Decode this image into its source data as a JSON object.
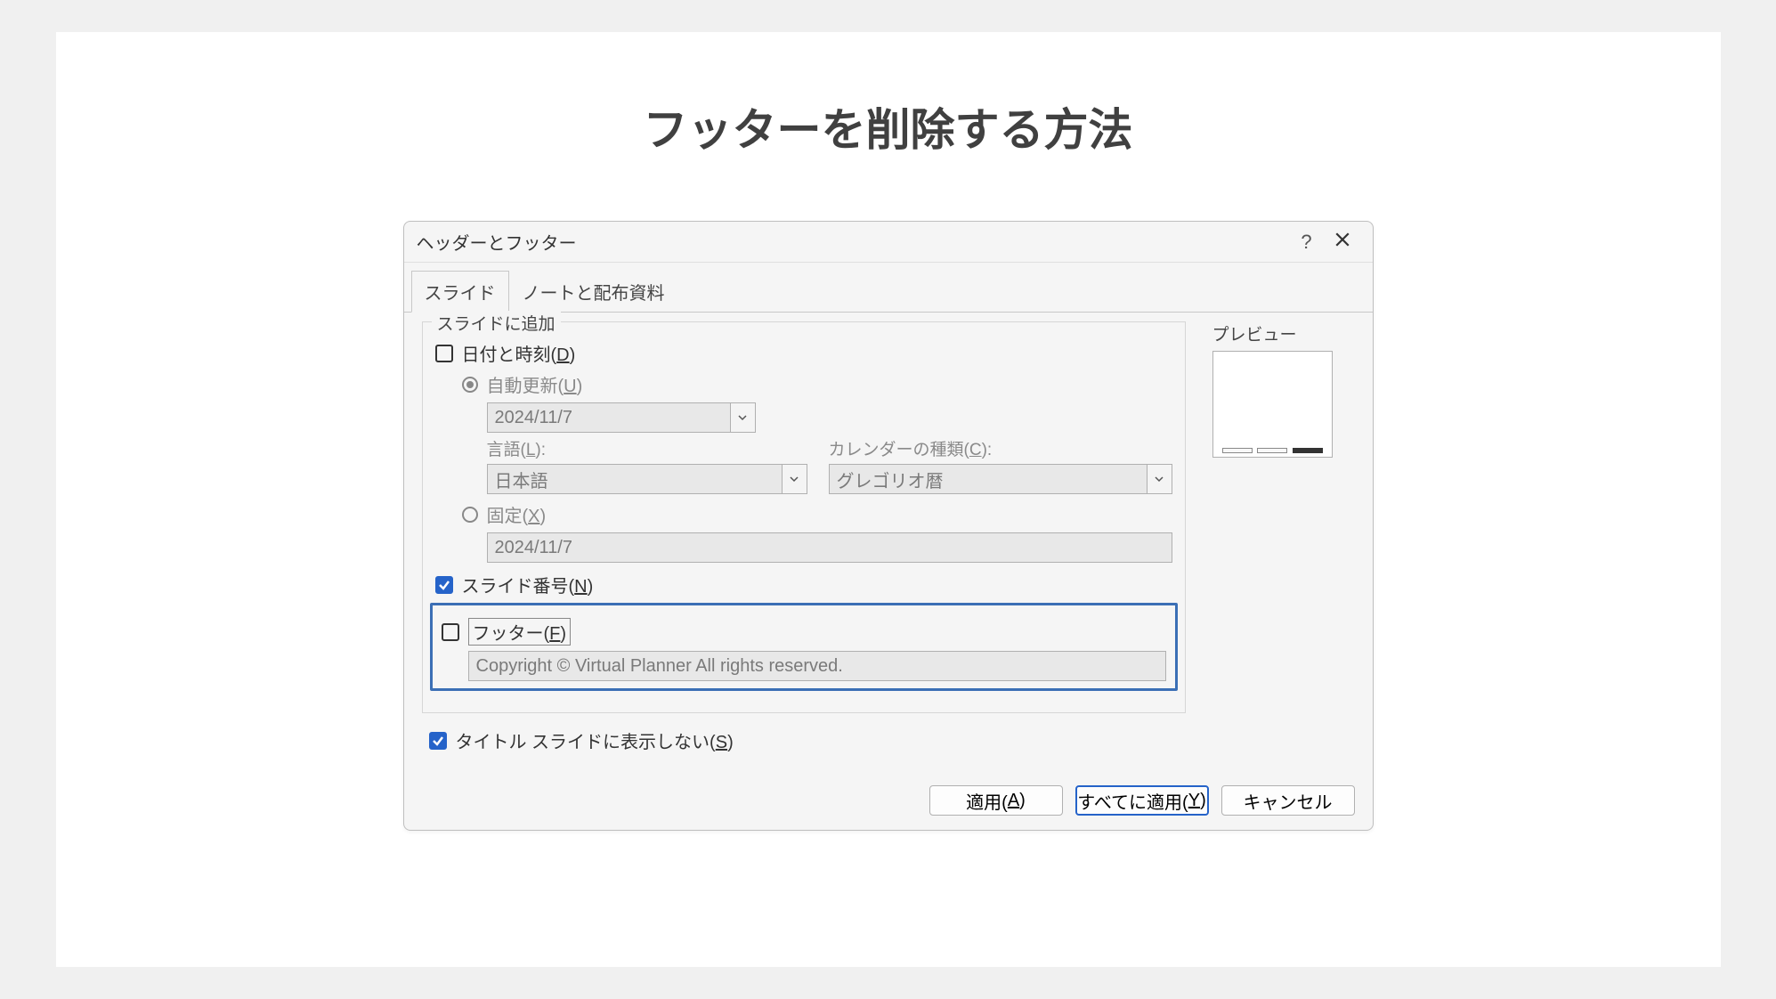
{
  "slide": {
    "title": "フッターを削除する方法"
  },
  "dialog": {
    "title": "ヘッダーとフッター",
    "help": "?",
    "tabs": {
      "slide": "スライド",
      "notes": "ノートと配布資料"
    },
    "group_legend": "スライドに追加",
    "datetime": {
      "label_pre": "日付と時刻(",
      "label_u": "D",
      "label_post": ")",
      "auto_pre": "自動更新(",
      "auto_u": "U",
      "auto_post": ")",
      "auto_value": "2024/11/7",
      "lang_label_pre": "言語(",
      "lang_label_u": "L",
      "lang_label_post": "):",
      "lang_value": "日本語",
      "cal_label_pre": "カレンダーの種類(",
      "cal_label_u": "C",
      "cal_label_post": "):",
      "cal_value": "グレゴリオ暦",
      "fixed_pre": "固定(",
      "fixed_u": "X",
      "fixed_post": ")",
      "fixed_value": "2024/11/7"
    },
    "slidenum": {
      "pre": "スライド番号(",
      "u": "N",
      "post": ")"
    },
    "footer": {
      "pre": "フッター(",
      "u": "F",
      "post": ")",
      "value": "Copyright © Virtual Planner All rights reserved."
    },
    "hide_title": {
      "pre": "タイトル スライドに表示しない(",
      "u": "S",
      "post": ")"
    },
    "preview_legend": "プレビュー",
    "buttons": {
      "apply_pre": "適用(",
      "apply_u": "A",
      "apply_post": ")",
      "apply_all_pre": "すべてに適用(",
      "apply_all_u": "Y",
      "apply_all_post": ")",
      "cancel": "キャンセル"
    }
  }
}
